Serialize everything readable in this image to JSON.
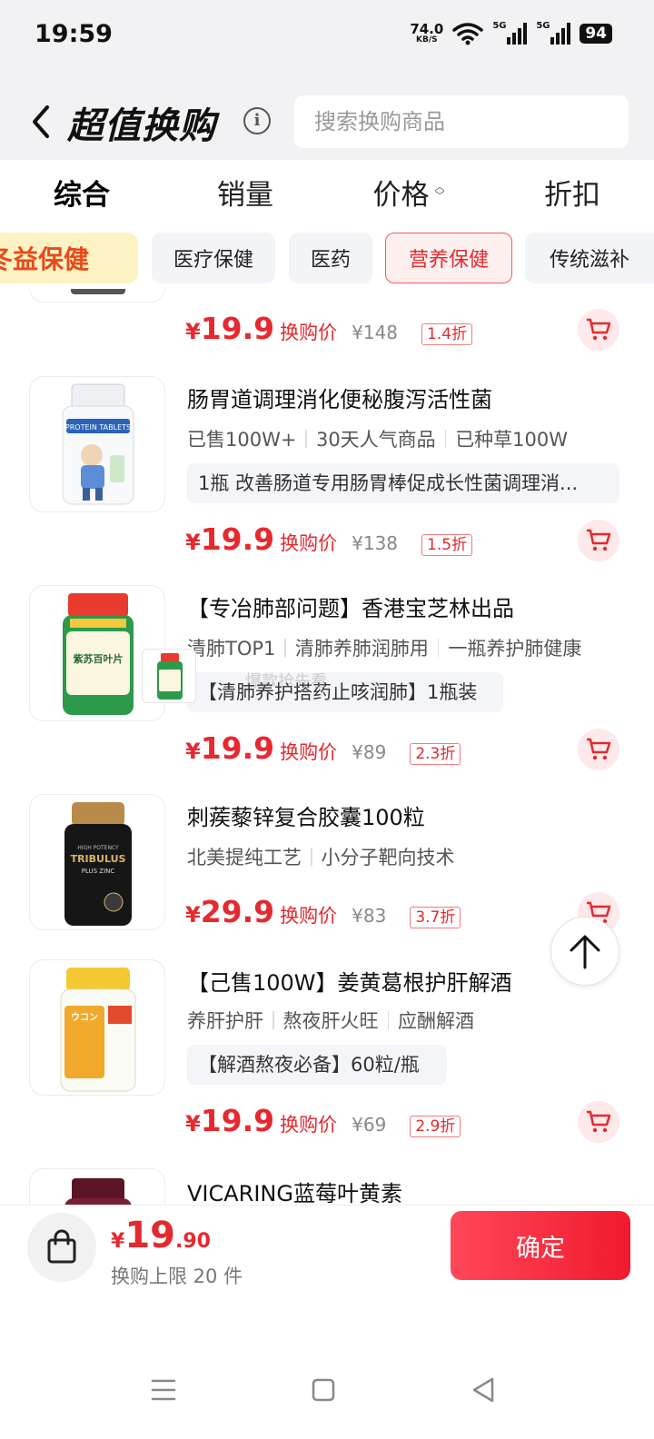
{
  "status": {
    "time": "19:59",
    "net_speed": "74.0",
    "net_unit": "KB/S",
    "signal1_tag": "5G",
    "signal2_tag": "5G",
    "battery": "94"
  },
  "header": {
    "title": "超值换购",
    "search_placeholder": "搜索换购商品"
  },
  "sort_tabs": [
    {
      "label": "综合",
      "active": true
    },
    {
      "label": "销量"
    },
    {
      "label": "价格"
    },
    {
      "label": "折扣"
    }
  ],
  "categories": [
    {
      "label": "冬益保健"
    },
    {
      "label": "医疗保健"
    },
    {
      "label": "医药"
    },
    {
      "label": "营养保健",
      "active": true
    },
    {
      "label": "传统滋补"
    }
  ],
  "price_label": "换购价",
  "currency": "¥",
  "products": [
    {
      "price": "19.9",
      "original": "¥148",
      "discount": "1.4折"
    },
    {
      "title": "肠胃道调理消化便秘腹泻活性菌",
      "tags": [
        "已售100W+",
        "30天人气商品",
        "已种草100W"
      ],
      "desc": "1瓶 改善肠道专用肠胃棒促成长性菌调理消...",
      "price": "19.9",
      "original": "¥138",
      "discount": "1.5折",
      "image_text": "PROTEIN TABLETS"
    },
    {
      "title": "【专冶肺部问题】香港宝芝林出品",
      "tags": [
        "清肺TOP1",
        "清肺养肺润肺用",
        "一瓶养护肺健康"
      ],
      "desc": "【清肺养护搭药止咳润肺】1瓶装",
      "price": "19.9",
      "original": "¥89",
      "discount": "2.3折",
      "image_text": "紫苏百叶片"
    },
    {
      "title": "刺蒺藜锌复合胶囊100粒",
      "tags": [
        "北美提纯工艺",
        "小分子靶向技术"
      ],
      "price": "29.9",
      "original": "¥83",
      "discount": "3.7折",
      "image_text": "TRIBULUS",
      "image_sub": "PLUS ZINC",
      "image_top": "HIGH POTENCY"
    },
    {
      "title": "【己售100W】姜黄葛根护肝解酒",
      "tags": [
        "养肝护肝",
        "熬夜肝火旺",
        "应酬解酒"
      ],
      "desc": "【解酒熬夜必备】60粒/瓶",
      "price": "19.9",
      "original": "¥69",
      "discount": "2.9折",
      "image_text": "ウコン"
    },
    {
      "title": "VICARING蓝莓叶黄素"
    }
  ],
  "watermark": "爆款抢先看",
  "bottom": {
    "currency": "¥",
    "total_int": "19",
    "total_dec": ".90",
    "limit": "换购上限 20 件",
    "confirm": "确定"
  },
  "colors": {
    "accent": "#e5292e",
    "confirm_start": "#ff4759",
    "confirm_end": "#f01b2d"
  }
}
